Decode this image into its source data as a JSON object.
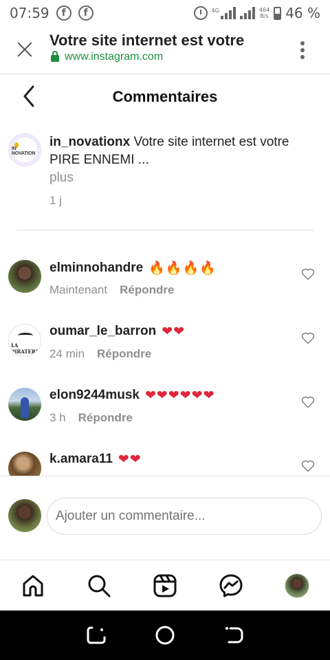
{
  "status_bar": {
    "time": "07:59",
    "facebook_glyph": "f",
    "network_label": "4G",
    "speed_value": "464",
    "speed_unit": "B/s",
    "battery": "46 %"
  },
  "browser": {
    "title": "Votre site internet est votre",
    "url": "www.instagram.com",
    "url_color": "#1e8e3e"
  },
  "header": {
    "title": "Commentaires"
  },
  "caption": {
    "avatar_logo": "IN NOVATION",
    "username": "in_novationx",
    "text": " Votre site internet est votre PIRE ENNEMI ...",
    "more": "plus",
    "time": "1 j"
  },
  "comments": [
    {
      "username": "elminnohandre",
      "emoji": "🔥🔥🔥🔥",
      "emoji_type": "fire",
      "time": "Maintenant",
      "reply": "Répondre"
    },
    {
      "username": "oumar_le_barron",
      "emoji": "❤❤",
      "emoji_type": "heart",
      "time": "24 min",
      "reply": "Répondre",
      "avatar_label": "LA PIRATERIE"
    },
    {
      "username": "elon9244musk",
      "emoji": "❤❤❤❤❤❤",
      "emoji_type": "heart",
      "time": "3 h",
      "reply": "Répondre"
    },
    {
      "username": "k.amara11",
      "emoji": "❤❤",
      "emoji_type": "heart"
    }
  ],
  "composer": {
    "placeholder": "Ajouter un commentaire..."
  },
  "colors": {
    "accent": "#262626",
    "muted": "#8e8e8e",
    "heart": "#e0263a",
    "fire": "#ff8a00"
  },
  "icons": {
    "nav": [
      "home-icon",
      "search-icon",
      "reels-icon",
      "messenger-icon",
      "profile-avatar"
    ],
    "android": [
      "recents-icon",
      "home-circle-icon",
      "back-icon"
    ]
  }
}
